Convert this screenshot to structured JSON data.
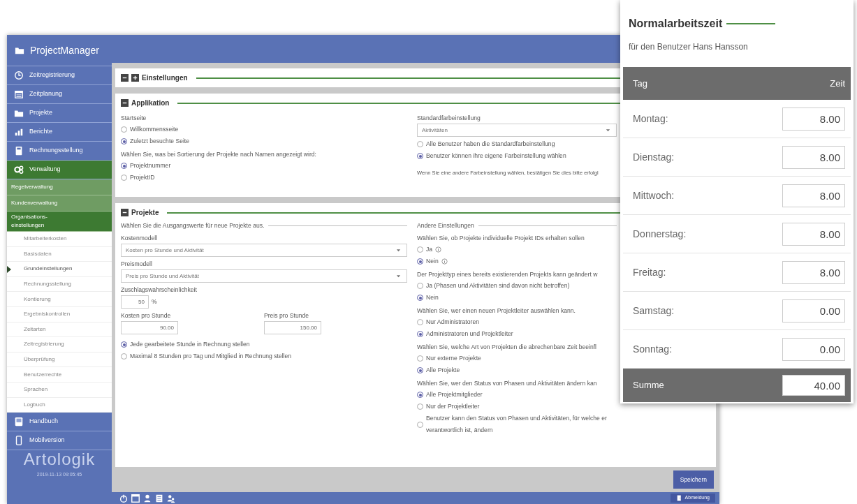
{
  "sidebar": {
    "brand": "ProjectManager",
    "items": [
      {
        "label": "Zeitregistrierung",
        "selected": false
      },
      {
        "label": "Zeitplanung",
        "selected": false
      },
      {
        "label": "Projekte",
        "selected": false
      },
      {
        "label": "Berichte",
        "selected": false
      },
      {
        "label": "Rechnungsstellung",
        "selected": false
      },
      {
        "label": "Verwaltung",
        "selected": true,
        "children": [
          {
            "label": "Regelverwaltung",
            "selected": false
          },
          {
            "label": "Kundenverwaltung",
            "selected": false
          },
          {
            "label": "Organisations-einstellungen",
            "selected": true,
            "children": [
              {
                "label": "Mitarbeiterkosten",
                "selected": false
              },
              {
                "label": "Basisdaten",
                "selected": false
              },
              {
                "label": "Grundeinstellungen",
                "selected": true
              },
              {
                "label": "Rechnungsstellung",
                "selected": false
              },
              {
                "label": "Kontierung",
                "selected": false
              },
              {
                "label": "Ergebniskontrollen",
                "selected": false
              },
              {
                "label": "Zeitarten",
                "selected": false
              },
              {
                "label": "Zeitregistrierung",
                "selected": false
              },
              {
                "label": "Überprüfung",
                "selected": false
              },
              {
                "label": "Benutzerrechte",
                "selected": false
              },
              {
                "label": "Sprachen",
                "selected": false
              },
              {
                "label": "Logbuch",
                "selected": false
              }
            ]
          }
        ]
      },
      {
        "label": "Handbuch",
        "selected": false
      },
      {
        "label": "Mobilversion",
        "selected": false
      }
    ],
    "logo": "Artologik",
    "timestamp": "2019-11-13 09:05:45"
  },
  "settings_title": "Einstellungen",
  "sections": [
    {
      "title": "Applikation",
      "expanded": true,
      "left": [
        {
          "kind": "radio_group",
          "label": "Startseite",
          "options": [
            {
              "label": "Willkommensseite",
              "selected": false
            },
            {
              "label": "Zuletzt besuchte Seite",
              "selected": true
            }
          ]
        },
        {
          "kind": "radio_group",
          "label": "Wählen Sie, was bei Sortierung der Projekte nach Namen angezeigt wird:",
          "options": [
            {
              "label": "Projektnummer",
              "selected": true
            },
            {
              "label": "ProjektID",
              "selected": false
            }
          ]
        }
      ],
      "right": [
        {
          "kind": "select",
          "label": "Standardfarbeinstellung",
          "value": "Aktivitäten"
        },
        {
          "kind": "radio_group",
          "options": [
            {
              "label": "Alle Benutzer haben die Standardfarbeinstellung",
              "selected": false
            },
            {
              "label": "Benutzer können ihre eigene Farbeinstellung wählen",
              "selected": true
            }
          ]
        },
        {
          "kind": "note",
          "text": "Wenn Sie eine andere Farbeinstellung wählen, bestätigen Sie dies bitte erfolgl"
        }
      ]
    },
    {
      "title": "Projekte",
      "expanded": true,
      "left": [
        {
          "kind": "heading",
          "text": "Wählen Sie die Ausgangswerte für neue Projekte aus."
        },
        {
          "kind": "select",
          "label": "Kostenmodell",
          "value": "Kosten pro Stunde und Aktivität"
        },
        {
          "kind": "select",
          "label": "Preismodell",
          "value": "Preis pro Stunde und Aktivität"
        },
        {
          "kind": "number",
          "label": "Zuschlagswahrscheinlichkeit",
          "value": "50",
          "unit": "%"
        },
        {
          "kind": "pair",
          "items": [
            {
              "label": "Kosten pro Stunde",
              "value": "90.00"
            },
            {
              "label": "Preis pro Stunde",
              "value": "150.00"
            }
          ]
        },
        {
          "kind": "radio_group",
          "options": [
            {
              "label": "Jede gearbeitete Stunde in Rechnung stellen",
              "selected": true
            },
            {
              "label": "Maximal 8 Stunden pro Tag und Mitglied in Rechnung stellen",
              "selected": false
            }
          ]
        }
      ],
      "right": [
        {
          "kind": "heading",
          "text": "Andere Einstellungen"
        },
        {
          "kind": "radio_group",
          "label": "Wählen Sie, ob Projekte individuelle Projekt IDs erhalten sollen",
          "options": [
            {
              "label": "Ja",
              "selected": false,
              "info": true
            },
            {
              "label": "Nein",
              "selected": true,
              "info": true
            }
          ]
        },
        {
          "kind": "radio_group",
          "label": "Der Projekttyp eines bereits existierenden Projekts kann geändert w",
          "options": [
            {
              "label": "Ja (Phasen und Aktivitäten sind davon nicht betroffen)",
              "selected": false
            },
            {
              "label": "Nein",
              "selected": true
            }
          ]
        },
        {
          "kind": "radio_group",
          "label": "Wählen Sie, wer einen neuen Projektleiter auswählen kann.",
          "options": [
            {
              "label": "Nur Administratoren",
              "selected": false
            },
            {
              "label": "Administratoren und Projektleiter",
              "selected": true
            }
          ]
        },
        {
          "kind": "radio_group",
          "label": "Wählen Sie, welche Art von Projekten die abrechenbare Zeit beeinfl",
          "options": [
            {
              "label": "Nur externe Projekte",
              "selected": false
            },
            {
              "label": "Alle Projekte",
              "selected": true
            }
          ]
        },
        {
          "kind": "radio_group",
          "label": "Wählen Sie, wer den Status von Phasen und Aktivitäten ändern kan",
          "options": [
            {
              "label": "Alle Projektmitglieder",
              "selected": true
            },
            {
              "label": "Nur der Projektleiter",
              "selected": false
            },
            {
              "label": "Benutzer kann den Status von Phasen und Aktivitäten, für welche er verantwortlich ist, ändern",
              "selected": false
            }
          ]
        }
      ]
    }
  ],
  "save_button": "Speichern",
  "logout_button": "Abmeldung",
  "popup": {
    "title": "Normalarbeitszeit",
    "subtitle": "für den Benutzer Hans Hansson",
    "columns": [
      "Tag",
      "Zeit"
    ],
    "rows": [
      {
        "day": "Montag:",
        "time": "8.00"
      },
      {
        "day": "Dienstag:",
        "time": "8.00"
      },
      {
        "day": "Mittwoch:",
        "time": "8.00"
      },
      {
        "day": "Donnerstag:",
        "time": "8.00"
      },
      {
        "day": "Freitag:",
        "time": "8.00"
      },
      {
        "day": "Samstag:",
        "time": "0.00"
      },
      {
        "day": "Sonntag:",
        "time": "0.00"
      }
    ],
    "total": {
      "label": "Summe",
      "value": "40.00"
    }
  }
}
